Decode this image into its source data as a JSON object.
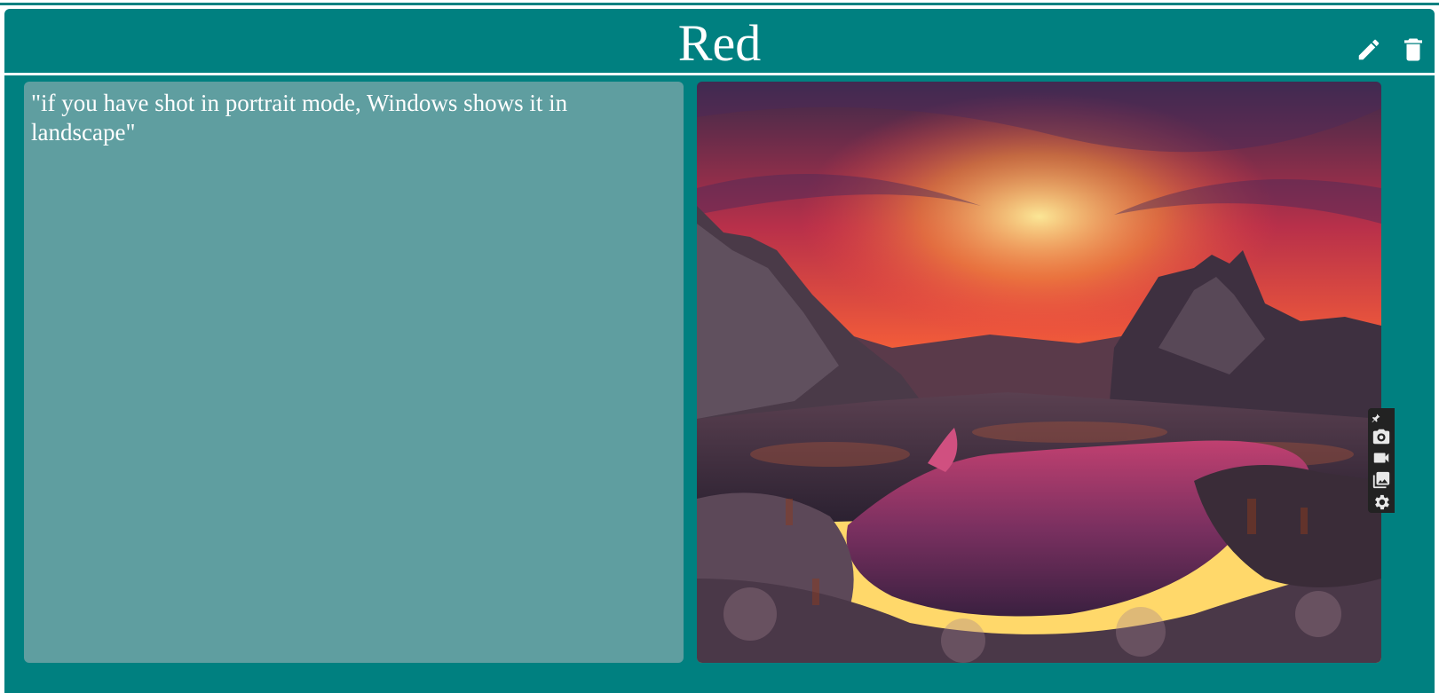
{
  "card": {
    "title": "Red",
    "note_text": "\"if you have shot in portrait mode, Windows shows it in landscape\"",
    "photo_alt": "Sunset over mountain lake",
    "actions": [
      {
        "name": "edit",
        "icon": "pencil-icon"
      },
      {
        "name": "delete",
        "icon": "trash-icon"
      }
    ]
  },
  "side_toolbar": {
    "items": [
      "pin-icon",
      "camera-icon",
      "video-icon",
      "gallery-icon",
      "gear-icon"
    ]
  },
  "colors": {
    "card_bg": "#008080",
    "note_bg": "#5f9ea0",
    "text": "#ffffff",
    "toolbar_bg": "#222222"
  }
}
